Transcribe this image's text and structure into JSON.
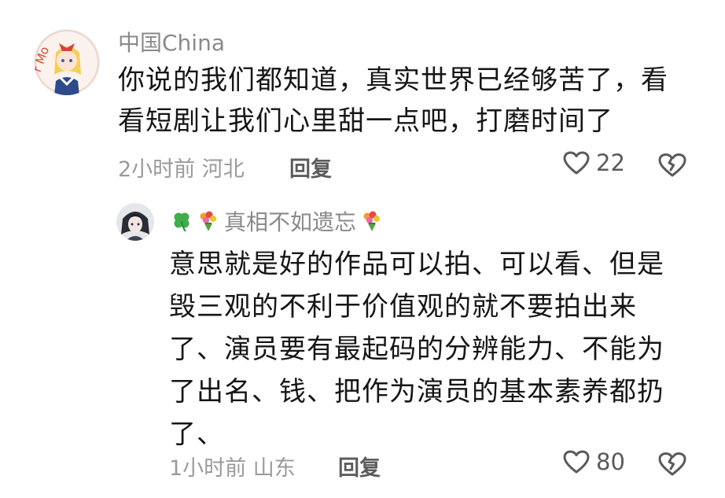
{
  "comments": [
    {
      "username": "中国China",
      "text": "你说的我们都知道，真实世界已经够苦了，看\n看短剧让我们心里甜一点吧，打磨时间了",
      "time": "2小时前",
      "location": "河北",
      "reply_label": "回复",
      "like_count": "22"
    },
    {
      "username": "真相不如遗忘",
      "username_icons": [
        "clover-icon",
        "bouquet-icon",
        "bouquet-icon"
      ],
      "text": "意思就是好的作品可以拍、可以看、但是\n毁三观的不利于价值观的就不要拍出来\n了、演员要有最起码的分辨能力、不能为\n了出名、钱、把作为演员的基本素养都扔\n了、",
      "time": "1小时前",
      "location": "山东",
      "reply_label": "回复",
      "like_count": "80"
    }
  ],
  "colors": {
    "text_primary": "#161616",
    "text_secondary": "#8a8a8a",
    "icon": "#5a5a5a"
  }
}
